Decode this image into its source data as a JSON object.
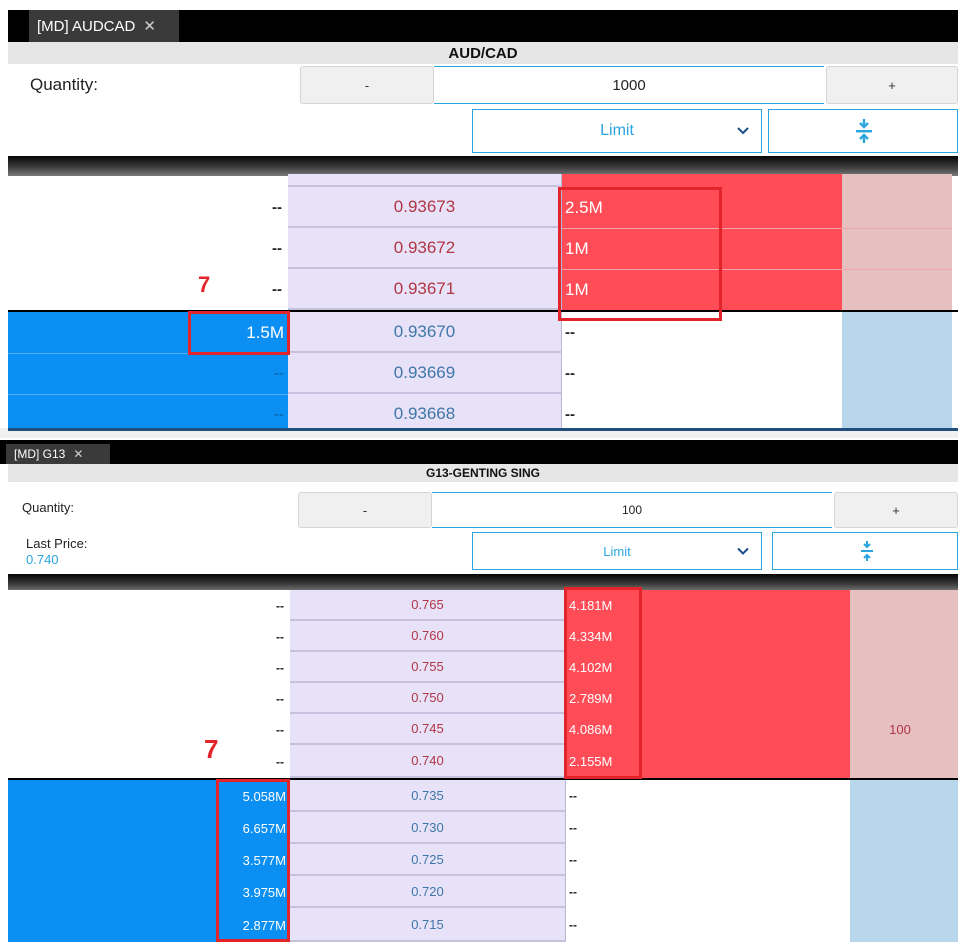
{
  "panel1": {
    "tab_label": "[MD] AUDCAD",
    "tab_close": "✕",
    "title": "AUD/CAD",
    "quantity_label": "Quantity:",
    "minus_label": "-",
    "quantity_value": "1000",
    "plus_label": "+",
    "order_type": "Limit",
    "collapse_icon": "collapse-vertical-icon",
    "annotation": "7",
    "asks": [
      {
        "bid": "--",
        "price": "0.93673",
        "qty": "2.5M"
      },
      {
        "bid": "--",
        "price": "0.93672",
        "qty": "1M"
      },
      {
        "bid": "--",
        "price": "0.93671",
        "qty": "1M"
      }
    ],
    "bids": [
      {
        "qty": "1.5M",
        "price": "0.93670",
        "ask": "--"
      },
      {
        "qty": "--",
        "price": "0.93669",
        "ask": "--"
      },
      {
        "qty": "--",
        "price": "0.93668",
        "ask": "--"
      }
    ]
  },
  "panel2": {
    "tab_label": "[MD] G13",
    "tab_close": "✕",
    "title": "G13-GENTING SING",
    "quantity_label": "Quantity:",
    "last_price_label": "Last Price:",
    "last_price_value": "0.740",
    "minus_label": "-",
    "quantity_value": "100",
    "plus_label": "+",
    "order_type": "Limit",
    "collapse_icon": "collapse-vertical-icon",
    "annotation": "7",
    "pink_column_value": "100",
    "asks": [
      {
        "bid": "--",
        "price": "0.765",
        "qty": "4.181M"
      },
      {
        "bid": "--",
        "price": "0.760",
        "qty": "4.334M"
      },
      {
        "bid": "--",
        "price": "0.755",
        "qty": "4.102M"
      },
      {
        "bid": "--",
        "price": "0.750",
        "qty": "2.789M"
      },
      {
        "bid": "--",
        "price": "0.745",
        "qty": "4.086M"
      },
      {
        "bid": "--",
        "price": "0.740",
        "qty": "2.155M"
      }
    ],
    "bids": [
      {
        "qty": "5.058M",
        "price": "0.735",
        "ask": "--"
      },
      {
        "qty": "6.657M",
        "price": "0.730",
        "ask": "--"
      },
      {
        "qty": "3.577M",
        "price": "0.725",
        "ask": "--"
      },
      {
        "qty": "3.975M",
        "price": "0.720",
        "ask": "--"
      },
      {
        "qty": "2.877M",
        "price": "0.715",
        "ask": "--"
      }
    ]
  },
  "colors": {
    "ask_red": "#ff4c57",
    "bid_blue": "#0b8ff2",
    "accent": "#2aa5e0",
    "price_bg": "#e8e2f8",
    "highlight_red": "#e4242b"
  }
}
